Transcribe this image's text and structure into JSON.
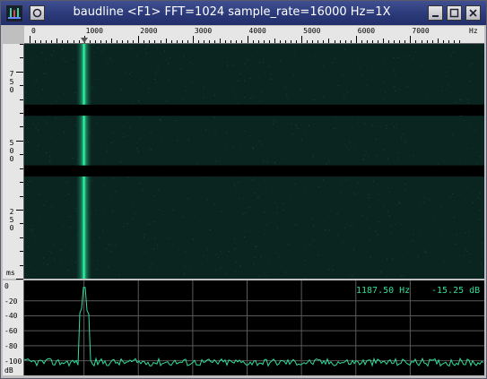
{
  "window": {
    "title": "baudline  <F1> FFT=1024 sample_rate=16000 Hz=1X"
  },
  "titlebar_buttons": {
    "menu_icon": "circle-menu-icon",
    "minimize_icon": "minimize-icon",
    "maximize_icon": "maximize-icon",
    "close_icon": "close-icon"
  },
  "ruler": {
    "labels": [
      "0",
      "1000",
      "2000",
      "3000",
      "4000",
      "5000",
      "6000",
      "7000"
    ],
    "unit": "Hz",
    "marker_freq": 1000
  },
  "time_axis": {
    "labels": [
      "750",
      "500",
      "250"
    ],
    "unit": "ms"
  },
  "spectrogram": {
    "tone_freq_hz": 1000,
    "max_freq_hz": 8000,
    "gaps_ms": [
      [
        630,
        590
      ],
      [
        410,
        370
      ]
    ],
    "total_ms": 850
  },
  "spectrum": {
    "db_labels": [
      "0",
      "-20",
      "-40",
      "-60",
      "-80",
      "-100",
      "dB"
    ],
    "readout_freq": "1187.50 Hz",
    "readout_db": "-15.25 dB",
    "peak_freq_hz": 1000,
    "noise_floor_db": -102
  },
  "colors": {
    "spectrogram_bg": "#0a2420",
    "tone": "#33ffaa",
    "trace": "#33dd99",
    "titlebar": "#2a3878"
  }
}
